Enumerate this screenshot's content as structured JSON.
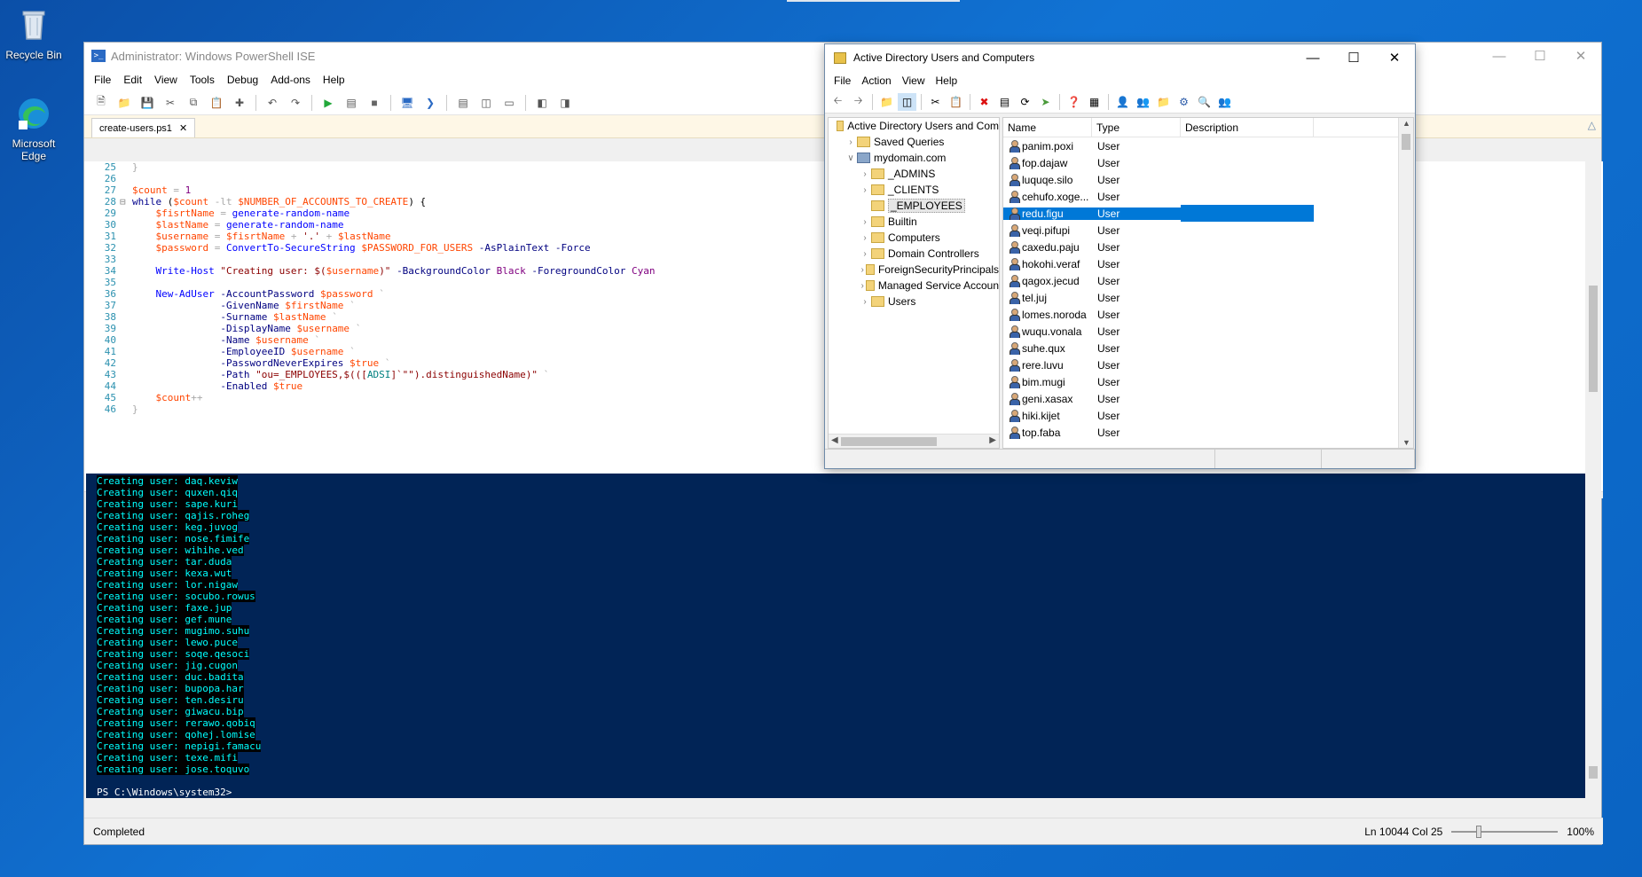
{
  "desktop": {
    "icons": [
      {
        "label": "Recycle Bin"
      },
      {
        "label": "Microsoft Edge"
      }
    ]
  },
  "ise": {
    "title": "Administrator: Windows PowerShell ISE",
    "menu": [
      "File",
      "Edit",
      "View",
      "Tools",
      "Debug",
      "Add-ons",
      "Help"
    ],
    "tab": "create-users.ps1",
    "status": "Completed",
    "position": "Ln 10044  Col 25",
    "zoom": "100%",
    "code_start_line": 25,
    "console_lines": [
      "Creating user: daq.keviw",
      "Creating user: quxen.qiq",
      "Creating user: sape.kuri",
      "Creating user: qajis.roheg",
      "Creating user: keg.juvog",
      "Creating user: nose.fimife",
      "Creating user: wihihe.ved",
      "Creating user: tar.duda",
      "Creating user: kexa.wut",
      "Creating user: lor.nigaw",
      "Creating user: socubo.rowus",
      "Creating user: faxe.jup",
      "Creating user: gef.mune",
      "Creating user: mugimo.suhu",
      "Creating user: lewo.puce",
      "Creating user: soqe.qesoci",
      "Creating user: jig.cugon",
      "Creating user: duc.badita",
      "Creating user: bupopa.har",
      "Creating user: ten.desiru",
      "Creating user: giwacu.bip",
      "Creating user: rerawo.qobiq",
      "Creating user: qohej.lomise",
      "Creating user: nepigi.famacu",
      "Creating user: texe.mifi",
      "Creating user: jose.toquvo"
    ],
    "prompt": "PS C:\\Windows\\system32>"
  },
  "aduc": {
    "title": "Active Directory Users and Computers",
    "menu": [
      "File",
      "Action",
      "View",
      "Help"
    ],
    "tree": [
      {
        "label": "Active Directory Users and Com",
        "indent": 0,
        "expander": "",
        "icon": "aduc",
        "selected": false
      },
      {
        "label": "Saved Queries",
        "indent": 1,
        "expander": ">",
        "icon": "folder",
        "selected": false
      },
      {
        "label": "mydomain.com",
        "indent": 1,
        "expander": "v",
        "icon": "domain",
        "selected": false
      },
      {
        "label": "_ADMINS",
        "indent": 2,
        "expander": ">",
        "icon": "folder",
        "selected": false
      },
      {
        "label": "_CLIENTS",
        "indent": 2,
        "expander": ">",
        "icon": "folder",
        "selected": false
      },
      {
        "label": "_EMPLOYEES",
        "indent": 2,
        "expander": "",
        "icon": "folder",
        "selected": true
      },
      {
        "label": "Builtin",
        "indent": 2,
        "expander": ">",
        "icon": "folder",
        "selected": false
      },
      {
        "label": "Computers",
        "indent": 2,
        "expander": ">",
        "icon": "folder",
        "selected": false
      },
      {
        "label": "Domain Controllers",
        "indent": 2,
        "expander": ">",
        "icon": "folder",
        "selected": false
      },
      {
        "label": "ForeignSecurityPrincipals",
        "indent": 2,
        "expander": ">",
        "icon": "folder",
        "selected": false
      },
      {
        "label": "Managed Service Accoun",
        "indent": 2,
        "expander": ">",
        "icon": "folder",
        "selected": false
      },
      {
        "label": "Users",
        "indent": 2,
        "expander": ">",
        "icon": "folder",
        "selected": false
      }
    ],
    "columns": [
      "Name",
      "Type",
      "Description"
    ],
    "rows": [
      {
        "name": "panim.poxi",
        "type": "User"
      },
      {
        "name": "fop.dajaw",
        "type": "User"
      },
      {
        "name": "luquqe.silo",
        "type": "User"
      },
      {
        "name": "cehufo.xoge...",
        "type": "User"
      },
      {
        "name": "redu.figu",
        "type": "User"
      },
      {
        "name": "veqi.pifupi",
        "type": "User"
      },
      {
        "name": "caxedu.paju",
        "type": "User"
      },
      {
        "name": "hokohi.veraf",
        "type": "User"
      },
      {
        "name": "qagox.jecud",
        "type": "User"
      },
      {
        "name": "tel.juj",
        "type": "User"
      },
      {
        "name": "lomes.noroda",
        "type": "User"
      },
      {
        "name": "wuqu.vonala",
        "type": "User"
      },
      {
        "name": "suhe.qux",
        "type": "User"
      },
      {
        "name": "rere.luvu",
        "type": "User"
      },
      {
        "name": "bim.mugi",
        "type": "User"
      },
      {
        "name": "geni.xasax",
        "type": "User"
      },
      {
        "name": "hiki.kijet",
        "type": "User"
      },
      {
        "name": "top.faba",
        "type": "User"
      }
    ],
    "selected_row": 4
  }
}
